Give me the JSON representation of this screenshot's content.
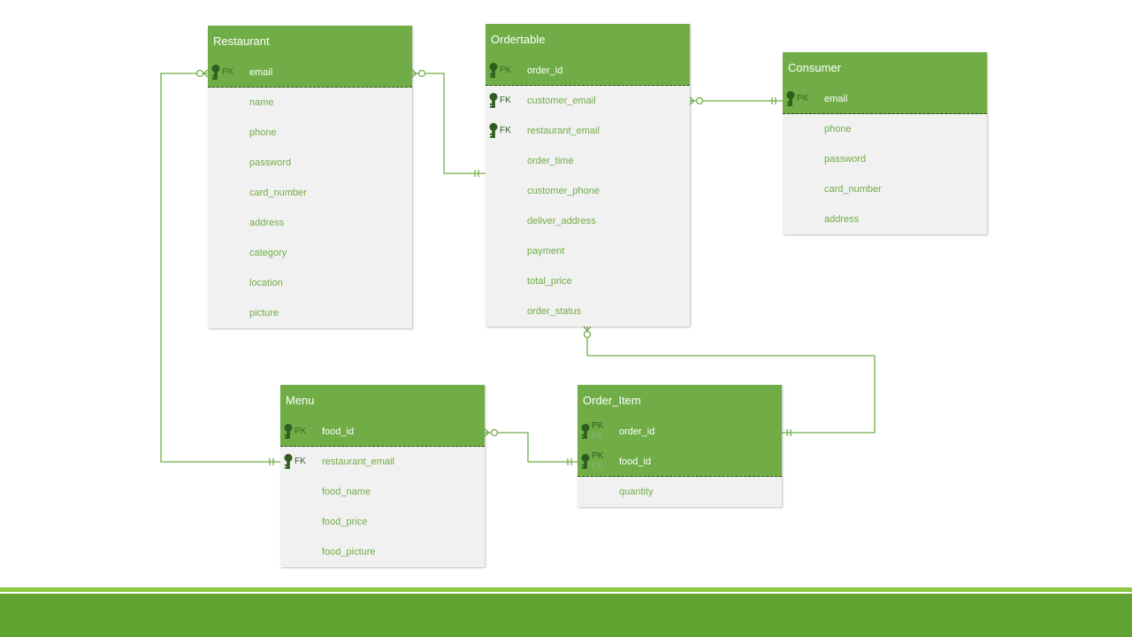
{
  "entities": {
    "restaurant": {
      "title": "Restaurant",
      "fields": [
        {
          "name": "email",
          "key": "PK",
          "key2": ""
        },
        {
          "name": "name",
          "key": "",
          "key2": ""
        },
        {
          "name": "phone",
          "key": "",
          "key2": ""
        },
        {
          "name": "password",
          "key": "",
          "key2": ""
        },
        {
          "name": "card_number",
          "key": "",
          "key2": ""
        },
        {
          "name": "address",
          "key": "",
          "key2": ""
        },
        {
          "name": "category",
          "key": "",
          "key2": ""
        },
        {
          "name": "location",
          "key": "",
          "key2": ""
        },
        {
          "name": "picture",
          "key": "",
          "key2": ""
        }
      ]
    },
    "ordertable": {
      "title": "Ordertable",
      "fields": [
        {
          "name": "order_id",
          "key": "PK",
          "key2": ""
        },
        {
          "name": "customer_email",
          "key": "FK",
          "key2": ""
        },
        {
          "name": "restaurant_email",
          "key": "FK",
          "key2": ""
        },
        {
          "name": "order_time",
          "key": "",
          "key2": ""
        },
        {
          "name": "customer_phone",
          "key": "",
          "key2": ""
        },
        {
          "name": "deliver_address",
          "key": "",
          "key2": ""
        },
        {
          "name": "payment",
          "key": "",
          "key2": ""
        },
        {
          "name": "total_price",
          "key": "",
          "key2": ""
        },
        {
          "name": "order_status",
          "key": "",
          "key2": ""
        }
      ]
    },
    "consumer": {
      "title": "Consumer",
      "fields": [
        {
          "name": "email",
          "key": "PK",
          "key2": ""
        },
        {
          "name": "phone",
          "key": "",
          "key2": ""
        },
        {
          "name": "password",
          "key": "",
          "key2": ""
        },
        {
          "name": "card_number",
          "key": "",
          "key2": ""
        },
        {
          "name": "address",
          "key": "",
          "key2": ""
        }
      ]
    },
    "menu": {
      "title": "Menu",
      "fields": [
        {
          "name": "food_id",
          "key": "PK",
          "key2": ""
        },
        {
          "name": "restaurant_email",
          "key": "FK",
          "key2": ""
        },
        {
          "name": "food_name",
          "key": "",
          "key2": ""
        },
        {
          "name": "food_price",
          "key": "",
          "key2": ""
        },
        {
          "name": "food_picture",
          "key": "",
          "key2": ""
        }
      ]
    },
    "order_item": {
      "title": "Order_Item",
      "fields": [
        {
          "name": "order_id",
          "key": "PK",
          "key2": "FK"
        },
        {
          "name": "food_id",
          "key": "PK",
          "key2": "FK"
        },
        {
          "name": "quantity",
          "key": "",
          "key2": ""
        }
      ]
    }
  },
  "colors": {
    "header": "#70ad47",
    "line": "#70ad47",
    "field_text": "#70ad47",
    "body": "#f1f1f1",
    "footer": "#62a432"
  },
  "relationships": [
    {
      "from": "restaurant.email",
      "to": "ordertable.restaurant_email",
      "from_card": "zero-or-many",
      "to_card": "one-and-only-one"
    },
    {
      "from": "consumer.email",
      "to": "ordertable.customer_email",
      "from_card": "one-and-only-one",
      "to_card": "zero-or-many"
    },
    {
      "from": "restaurant.email",
      "to": "menu.restaurant_email",
      "from_card": "zero-or-many",
      "to_card": "one-and-only-one"
    },
    {
      "from": "menu.food_id",
      "to": "order_item.food_id",
      "from_card": "zero-or-many",
      "to_card": "one-and-only-one"
    },
    {
      "from": "ordertable.order_id",
      "to": "order_item.order_id",
      "from_card": "zero-or-many",
      "to_card": "one-and-only-one"
    }
  ]
}
